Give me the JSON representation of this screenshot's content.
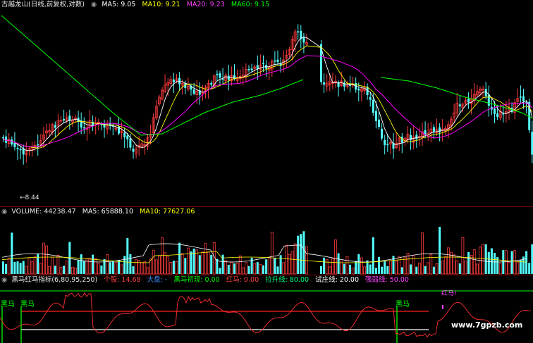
{
  "main_header": {
    "title": "古越龙山(日线,前复权,对数)",
    "ma5_label": "MA5: 9.05",
    "ma10_label": "MA10: 9.21",
    "ma20_label": "MA20: 9.23",
    "ma60_label": "MA60: 9.15"
  },
  "price_annotation": "8.44",
  "volume_header": {
    "title": "VOLUME: 44238.47",
    "ma5_label": "MA5: 65888.10",
    "ma10_label": "MA10: 77627.06"
  },
  "indicator_header": {
    "title": "黑马红马指标(6,80,95,250)",
    "stock_label": "个股: 14.68",
    "market_label": "大盘: -",
    "blackhorse_label": "黑马初现: 0.00",
    "redhorse_label": "红马: 0.00",
    "rise_label": "拉升线: 80.00",
    "test_label": "试庄线: 20.00",
    "band_label": "强弱线: 50.00"
  },
  "indicator_labels": {
    "blackhorse_1": "黑马",
    "blackhorse_2": "黑马",
    "blackhorse_3": "黑马",
    "redhorse": "红马!"
  },
  "watermark": "www.7gpzb.com",
  "colors": {
    "up": "#ff3c3c",
    "down": "#54ffff",
    "ma5": "#ffffff",
    "ma10": "#ffff00",
    "ma20": "#ff00ff",
    "ma60": "#00ff00",
    "rise_line": "#ff2020",
    "test_line": "#ffffff",
    "top_line": "#00ff00"
  }
}
